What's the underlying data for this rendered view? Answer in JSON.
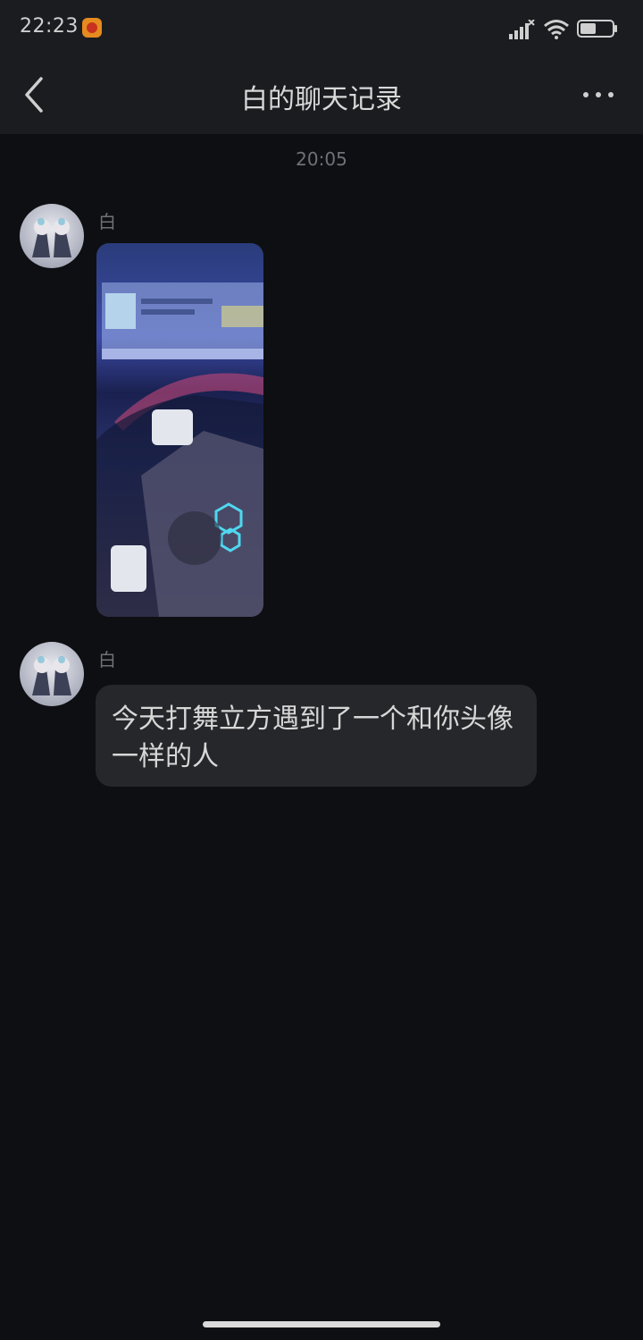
{
  "status_bar": {
    "time": "22:23",
    "icons": [
      "app-notification-icon",
      "signal-icon",
      "wifi-icon",
      "battery-icon"
    ],
    "battery_level": 0.5
  },
  "header": {
    "title": "白的聊天记录",
    "back_icon": "chevron-left-icon",
    "more_icon": "more-dots-icon"
  },
  "chat": {
    "timestamp": "20:05",
    "messages": [
      {
        "type": "image",
        "sender": "白"
      },
      {
        "type": "text",
        "sender": "白",
        "text": "今天打舞立方遇到了一个和你头像一样的人"
      }
    ]
  },
  "colors": {
    "background": "#0e0f12",
    "bar": "#1b1c20",
    "bubble": "#26272b",
    "text": "#d7d7d7",
    "muted": "#6f7177"
  }
}
